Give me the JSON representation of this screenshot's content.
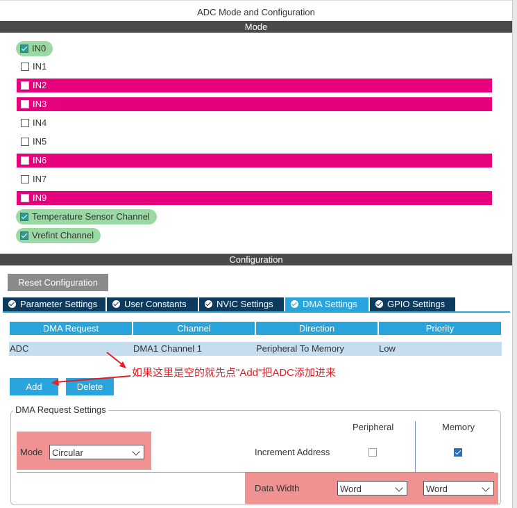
{
  "window": {
    "title": "ADC Mode and Configuration"
  },
  "mode": {
    "header": "Mode",
    "channels": [
      {
        "label": "IN0",
        "checked": true,
        "state": "enabled"
      },
      {
        "label": "IN1",
        "checked": false,
        "state": "normal"
      },
      {
        "label": "IN2",
        "checked": false,
        "state": "conflict"
      },
      {
        "label": "IN3",
        "checked": false,
        "state": "conflict"
      },
      {
        "label": "IN4",
        "checked": false,
        "state": "normal"
      },
      {
        "label": "IN5",
        "checked": false,
        "state": "normal"
      },
      {
        "label": "IN6",
        "checked": false,
        "state": "conflict"
      },
      {
        "label": "IN7",
        "checked": false,
        "state": "normal"
      },
      {
        "label": "IN9",
        "checked": false,
        "state": "conflict"
      },
      {
        "label": "Temperature Sensor Channel",
        "checked": true,
        "state": "enabled"
      },
      {
        "label": "Vrefint Channel",
        "checked": true,
        "state": "enabled"
      }
    ]
  },
  "configuration": {
    "header": "Configuration",
    "reset_button": "Reset Configuration",
    "tabs": [
      {
        "label": "Parameter Settings",
        "active": false
      },
      {
        "label": "User Constants",
        "active": false
      },
      {
        "label": "NVIC Settings",
        "active": false
      },
      {
        "label": "DMA Settings",
        "active": true
      },
      {
        "label": "GPIO Settings",
        "active": false
      }
    ]
  },
  "dma_table": {
    "columns": [
      "DMA Request",
      "Channel",
      "Direction",
      "Priority"
    ],
    "rows": [
      [
        "ADC",
        "DMA1 Channel 1",
        "Peripheral To Memory",
        "Low"
      ]
    ]
  },
  "buttons": {
    "add": "Add",
    "delete": "Delete"
  },
  "annotation": {
    "text": "如果这里是空的就先点\"Add\"把ADC添加进来"
  },
  "dma_request_settings": {
    "legend": "DMA Request Settings",
    "col_peripheral": "Peripheral",
    "col_memory": "Memory",
    "mode_label": "Mode",
    "mode_value": "Circular",
    "increment_label": "Increment Address",
    "increment_peripheral": false,
    "increment_memory": true,
    "data_width_label": "Data Width",
    "data_width_peripheral": "Word",
    "data_width_memory": "Word"
  },
  "colors": {
    "conflict": "#e6007e",
    "enabled": "#9ad9a3",
    "accent": "#2aa4dc",
    "tab_dark": "#0d3b5e",
    "highlight": "#f19292",
    "annotation": "#e31e24"
  }
}
